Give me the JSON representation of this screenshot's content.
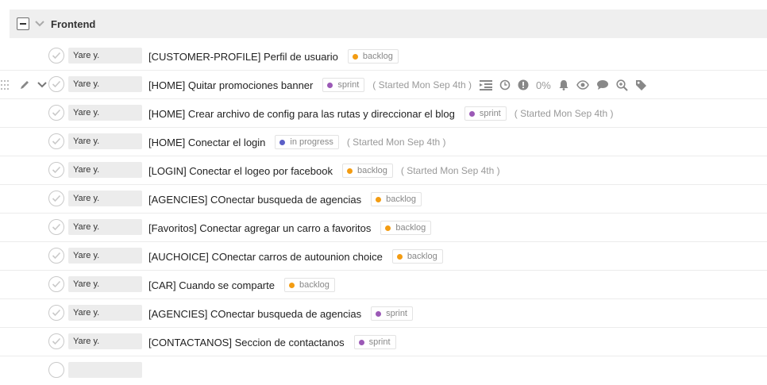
{
  "group": {
    "title": "Frontend"
  },
  "hover_actions": {
    "progress": "0%"
  },
  "colors": {
    "sprint": "#9b59b6",
    "backlog": "#f39c12",
    "in_progress": "#5b5fc7"
  },
  "tasks": [
    {
      "assignee": "Yare y.",
      "title": "[CUSTOMER-PROFILE] Perfil de usuario",
      "tag": "backlog",
      "meta": ""
    },
    {
      "assignee": "Yare y.",
      "title": "[HOME] Quitar promociones banner",
      "tag": "sprint",
      "meta": "( Started Mon Sep 4th )"
    },
    {
      "assignee": "Yare y.",
      "title": "[HOME] Crear archivo de config para las rutas y direccionar el blog",
      "tag": "sprint",
      "meta": "( Started Mon Sep 4th )"
    },
    {
      "assignee": "Yare y.",
      "title": "[HOME] Conectar el login",
      "tag": "in progress",
      "meta": "( Started Mon Sep 4th )"
    },
    {
      "assignee": "Yare y.",
      "title": "[LOGIN] Conectar el logeo por facebook",
      "tag": "backlog",
      "meta": "( Started Mon Sep 4th )"
    },
    {
      "assignee": "Yare y.",
      "title": "[AGENCIES] COnectar busqueda de agencias",
      "tag": "backlog",
      "meta": ""
    },
    {
      "assignee": "Yare y.",
      "title": "[Favoritos] Conectar agregar un carro a favoritos",
      "tag": "backlog",
      "meta": ""
    },
    {
      "assignee": "Yare y.",
      "title": "[AUCHOICE] COnectar carros de autounion choice",
      "tag": "backlog",
      "meta": ""
    },
    {
      "assignee": "Yare y.",
      "title": "[CAR] Cuando se comparte",
      "tag": "backlog",
      "meta": ""
    },
    {
      "assignee": "Yare y.",
      "title": "[AGENCIES] COnectar busqueda de agencias",
      "tag": "sprint",
      "meta": ""
    },
    {
      "assignee": "Yare y.",
      "title": "[CONTACTANOS] Seccion de contactanos",
      "tag": "sprint",
      "meta": ""
    }
  ]
}
